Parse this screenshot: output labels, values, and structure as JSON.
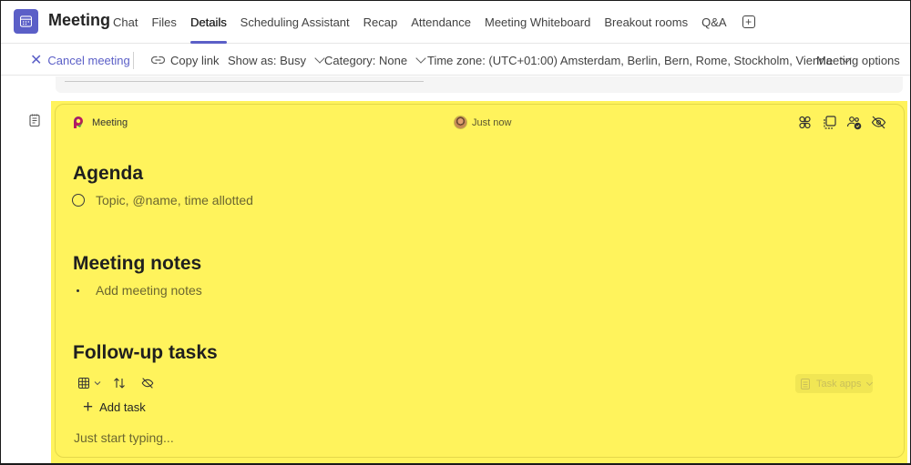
{
  "header": {
    "title": "Meeting",
    "tabs": [
      {
        "label": "Chat",
        "active": false
      },
      {
        "label": "Files",
        "active": false
      },
      {
        "label": "Details",
        "active": true
      },
      {
        "label": "Scheduling Assistant",
        "active": false
      },
      {
        "label": "Recap",
        "active": false
      },
      {
        "label": "Attendance",
        "active": false
      },
      {
        "label": "Meeting Whiteboard",
        "active": false
      },
      {
        "label": "Breakout rooms",
        "active": false
      },
      {
        "label": "Q&A",
        "active": false
      }
    ],
    "add_tab_icon": "plus-square-icon"
  },
  "toolbar": {
    "cancel_meeting": "Cancel meeting",
    "copy_link": "Copy link",
    "show_as": "Show as: Busy",
    "category": "Category: None",
    "time_zone": "Time zone: (UTC+01:00) Amsterdam, Berlin, Bern, Rome, Stockholm, Vienna",
    "meeting_options": "Meeting options"
  },
  "loop": {
    "component_name": "Meeting",
    "presence_text": "Just now",
    "header_icons": [
      "apps-icon",
      "copy-component-icon",
      "people-check-icon",
      "hide-icon"
    ],
    "sections": {
      "agenda": {
        "heading": "Agenda",
        "item_placeholder": "Topic, @name, time allotted"
      },
      "notes": {
        "heading": "Meeting notes",
        "item_placeholder": "Add meeting notes"
      },
      "tasks": {
        "heading": "Follow-up tasks",
        "task_apps_label": "Task apps",
        "add_task_label": "Add task"
      }
    },
    "footer_placeholder": "Just start typing..."
  },
  "colors": {
    "accent": "#5b5fc7",
    "loop_background": "#fff35c"
  }
}
